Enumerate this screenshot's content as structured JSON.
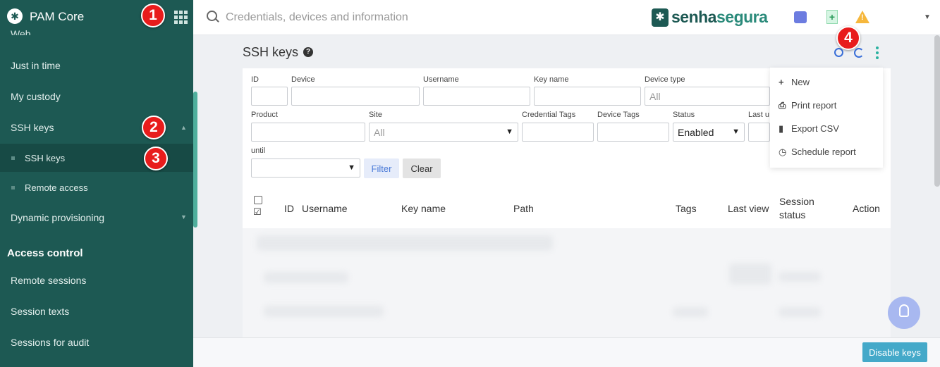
{
  "sidebar": {
    "app_title": "PAM Core",
    "partial_item": "Web",
    "items": {
      "just_in_time": "Just in time",
      "my_custody": "My custody",
      "ssh_keys": "SSH keys",
      "ssh_keys_sub": "SSH keys",
      "remote_access": "Remote access",
      "dynamic_provisioning": "Dynamic provisioning"
    },
    "section_access_control": "Access control",
    "access_items": {
      "remote_sessions": "Remote sessions",
      "session_texts": "Session texts",
      "sessions_for_audit": "Sessions for audit"
    }
  },
  "topbar": {
    "search_placeholder": "Credentials, devices and information",
    "brand_part1": "senha",
    "brand_part2": "segura"
  },
  "page": {
    "title": "SSH keys"
  },
  "filters": {
    "id": "ID",
    "device": "Device",
    "username": "Username",
    "key_name": "Key name",
    "device_type": "Device type",
    "device_type_value": "All",
    "product": "Product",
    "site": "Site",
    "site_value": "All",
    "credential_tags": "Credential Tags",
    "device_tags": "Device Tags",
    "status": "Status",
    "status_value": "Enabled",
    "last_u": "Last u",
    "until": "until",
    "filter_btn": "Filter",
    "clear_btn": "Clear"
  },
  "table": {
    "columns": {
      "id": "ID",
      "username": "Username",
      "key_name": "Key name",
      "path": "Path",
      "tags": "Tags",
      "last_view": "Last view",
      "session_status_1": "Session",
      "session_status_2": "status",
      "action": "Action"
    }
  },
  "menu": {
    "new": "New",
    "print_report": "Print report",
    "export_csv": "Export CSV",
    "schedule_report": "Schedule report"
  },
  "footer": {
    "disable_keys": "Disable keys"
  },
  "badges": [
    "1",
    "2",
    "3",
    "4"
  ]
}
